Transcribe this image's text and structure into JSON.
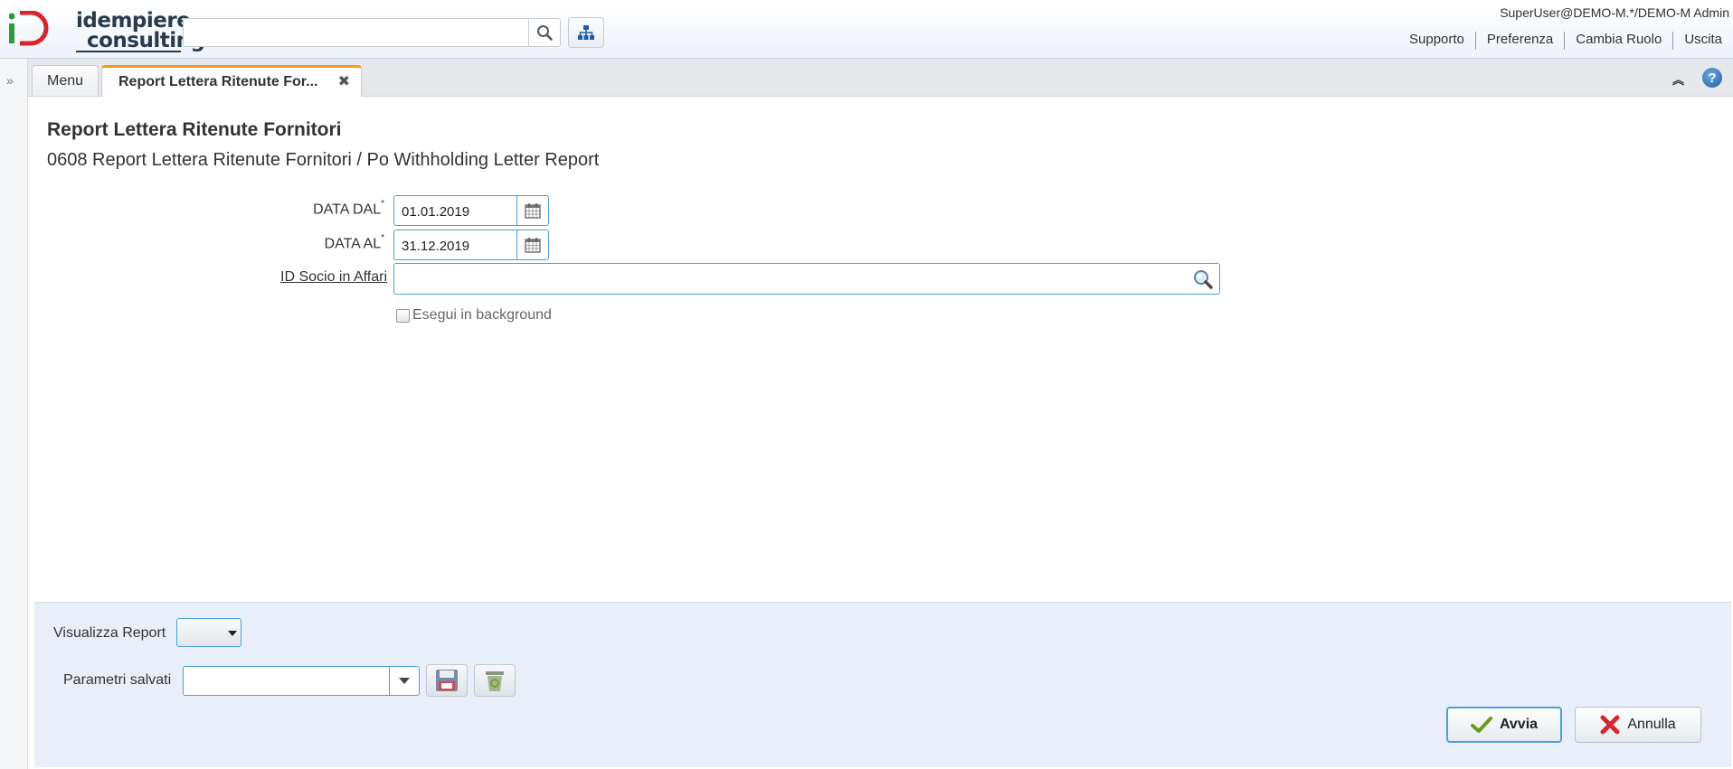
{
  "header": {
    "logo_line1": "idempiere",
    "logo_line2": "consulting",
    "search": {
      "value": "",
      "placeholder": ""
    },
    "user": "SuperUser@DEMO-M.*/DEMO-M Admin",
    "links": [
      "Supporto",
      "Preferenza",
      "Cambia Ruolo",
      "Uscita"
    ]
  },
  "tabs": {
    "menu_label": "Menu",
    "active_label": "Report Lettera Ritenute For...",
    "close_glyph": "✖"
  },
  "form": {
    "title": "Report Lettera Ritenute Fornitori",
    "subtitle": "0608 Report Lettera Ritenute Fornitori / Po Withholding Letter Report",
    "date_from": {
      "label": "DATA DAL",
      "required": "*",
      "value": "01.01.2019"
    },
    "date_to": {
      "label": "DATA AL",
      "required": "*",
      "value": "31.12.2019"
    },
    "business_partner": {
      "label": "ID Socio in Affari",
      "value": ""
    },
    "background": {
      "label": "Esegui in background",
      "checked": false
    }
  },
  "bottom": {
    "view_report_label": "Visualizza Report",
    "view_report_value": "",
    "saved_params_label": "Parametri salvati",
    "saved_params_value": "",
    "ok_label": "Avvia",
    "cancel_label": "Annulla"
  },
  "colors": {
    "accent_border": "#4aa0d8",
    "active_tab_top": "#f39a21",
    "bottom_panel": "#e8effa",
    "logo_green": "#2e9b3c",
    "logo_red": "#d9232d"
  },
  "icons": [
    "search-icon",
    "tree-icon",
    "expand-icon",
    "close-icon",
    "collapse-icon",
    "help-icon",
    "calendar-icon",
    "lookup-icon",
    "chevron-down-icon",
    "save-icon",
    "delete-icon",
    "check-icon",
    "cross-icon"
  ]
}
